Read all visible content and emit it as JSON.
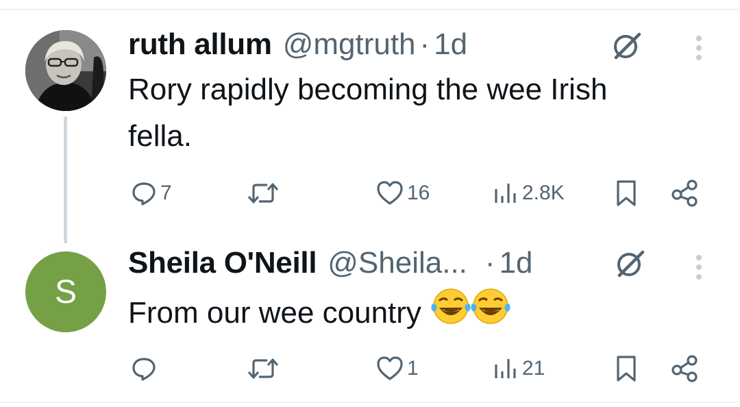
{
  "tweets": [
    {
      "name": "ruth allum",
      "handle": "@mgtruth",
      "separator": "·",
      "time": "1d",
      "text_line1": "Rory rapidly becoming the wee Irish",
      "text_line2": "fella.",
      "avatar_kind": "photo",
      "actions": {
        "replies": "7",
        "retweets": "",
        "likes": "16",
        "views": "2.8K"
      }
    },
    {
      "name": "Sheila O'Neill",
      "handle": "@Sheila...",
      "separator": "·",
      "time": "1d",
      "text": "From our wee country",
      "emoji": [
        "face-with-tears-of-joy",
        "face-with-tears-of-joy"
      ],
      "avatar_letter": "S",
      "avatar_color": "#76a045",
      "actions": {
        "replies": "",
        "retweets": "",
        "likes": "1",
        "views": "21"
      }
    }
  ],
  "colors": {
    "muted": "#536471",
    "text": "#0f1419",
    "thread_line": "#cfd9de"
  },
  "icons": [
    "grok-icon",
    "more-options-icon",
    "reply-icon",
    "retweet-icon",
    "like-icon",
    "views-icon",
    "bookmark-icon",
    "share-icon"
  ]
}
